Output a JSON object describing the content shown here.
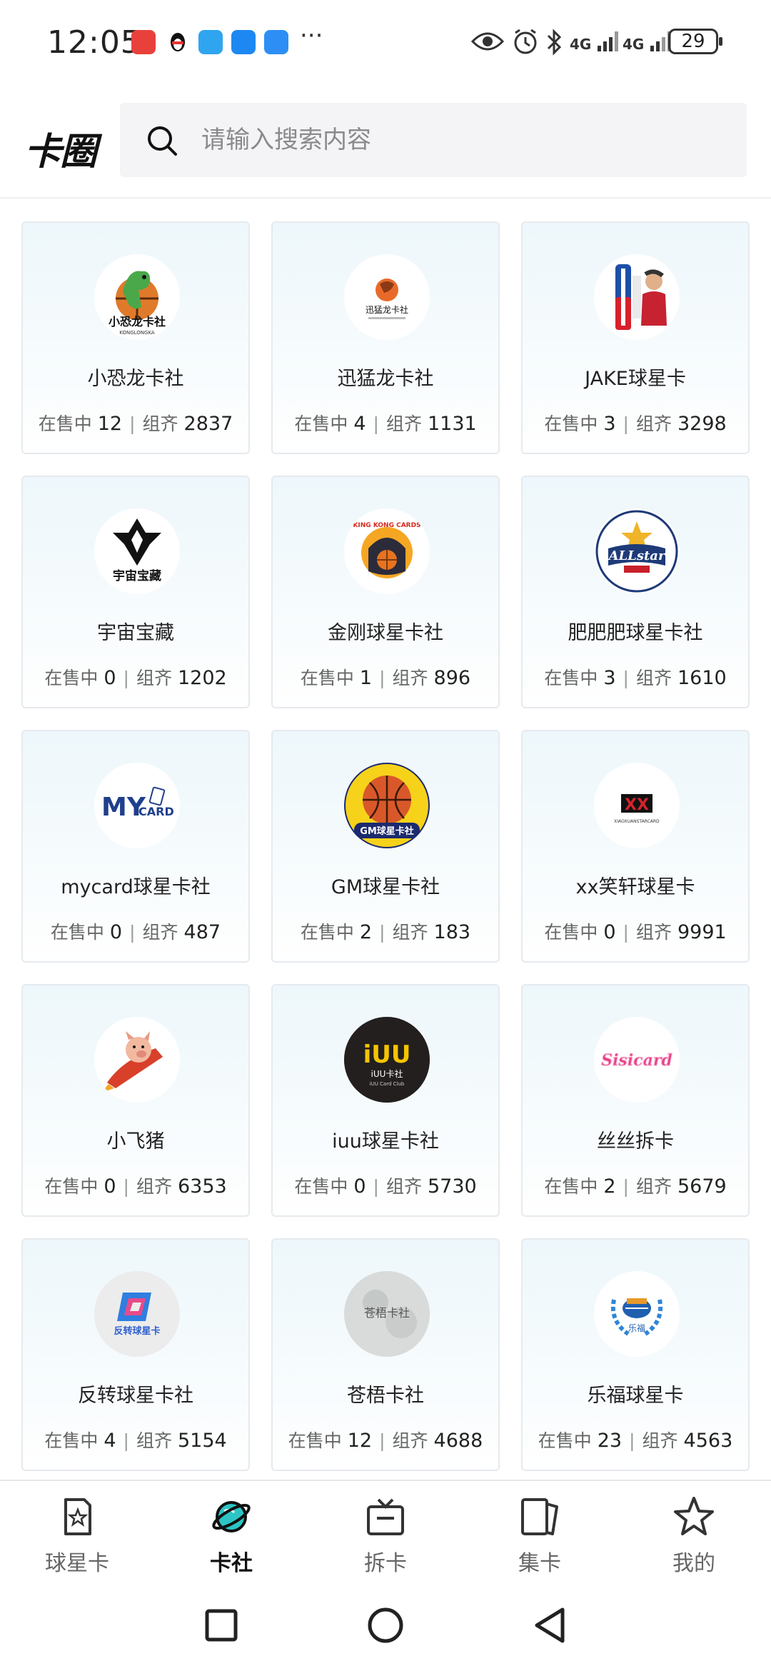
{
  "status_bar": {
    "time": "12:05",
    "network_1": "4G",
    "network_2": "4G",
    "battery": "29",
    "more": "···"
  },
  "header": {
    "brand": "卡圈",
    "search_placeholder": "请输入搜索内容"
  },
  "labels": {
    "on_sale": "在售中",
    "sets": "组齐"
  },
  "clubs": [
    {
      "name": "小恐龙卡社",
      "on_sale": "12",
      "sets": "2837",
      "logo": "dinosaur-logo"
    },
    {
      "name": "迅猛龙卡社",
      "on_sale": "4",
      "sets": "1131",
      "logo": "raptor-logo"
    },
    {
      "name": "JAKE球星卡",
      "on_sale": "3",
      "sets": "3298",
      "logo": "jake-logo"
    },
    {
      "name": "宇宙宝藏",
      "on_sale": "0",
      "sets": "1202",
      "logo": "universe-treasure-logo"
    },
    {
      "name": "金刚球星卡社",
      "on_sale": "1",
      "sets": "896",
      "logo": "king-kong-logo"
    },
    {
      "name": "肥肥肥球星卡社",
      "on_sale": "3",
      "sets": "1610",
      "logo": "allstar-logo"
    },
    {
      "name": "mycard球星卡社",
      "on_sale": "0",
      "sets": "487",
      "logo": "mycard-logo"
    },
    {
      "name": "GM球星卡社",
      "on_sale": "2",
      "sets": "183",
      "logo": "gm-basketball-logo"
    },
    {
      "name": "xx笑轩球星卡",
      "on_sale": "0",
      "sets": "9991",
      "logo": "xx-logo"
    },
    {
      "name": "小飞猪",
      "on_sale": "0",
      "sets": "6353",
      "logo": "flying-pig-logo"
    },
    {
      "name": "iuu球星卡社",
      "on_sale": "0",
      "sets": "5730",
      "logo": "iuu-logo"
    },
    {
      "name": "丝丝拆卡",
      "on_sale": "2",
      "sets": "5679",
      "logo": "sisi-logo"
    },
    {
      "name": "反转球星卡社",
      "on_sale": "4",
      "sets": "5154",
      "logo": "reverse-logo"
    },
    {
      "name": "苍梧卡社",
      "on_sale": "12",
      "sets": "4688",
      "logo": "cangwu-logo"
    },
    {
      "name": "乐福球星卡",
      "on_sale": "23",
      "sets": "4563",
      "logo": "lefu-logo"
    }
  ],
  "logo_text": {
    "dinosaur": "小恐龙卡社",
    "dinosaur_sub": "KONGLONGKA",
    "raptor": "迅猛龙卡社",
    "universe": "宇宙宝藏",
    "kingkong": "KING KONG CARDS",
    "allstar": "ALLstar",
    "mycard": "MY",
    "mycard_sub": "CARD",
    "gm": "GM球星卡社",
    "xx": "XX",
    "xx_sub": "XIAOXUANSTARCARD",
    "iuu": "iUU",
    "iuu_sub": "iUU卡社",
    "iuu_sub2": "iUU Card Club",
    "sisi": "Sisicard",
    "reverse": "反转球星卡",
    "cangwu": "苍梧卡社",
    "lefu": "乐福"
  },
  "bottom_nav": [
    {
      "label": "球星卡",
      "icon": "card-star-icon",
      "active": false
    },
    {
      "label": "卡社",
      "icon": "planet-icon",
      "active": true
    },
    {
      "label": "拆卡",
      "icon": "tv-icon",
      "active": false
    },
    {
      "label": "集卡",
      "icon": "collection-icon",
      "active": false
    },
    {
      "label": "我的",
      "icon": "star-icon",
      "active": false
    }
  ],
  "colors": {
    "accent_active": "#111111",
    "planet_icon": "#2ec4c4",
    "card_bg_top": "#eef7fb"
  }
}
